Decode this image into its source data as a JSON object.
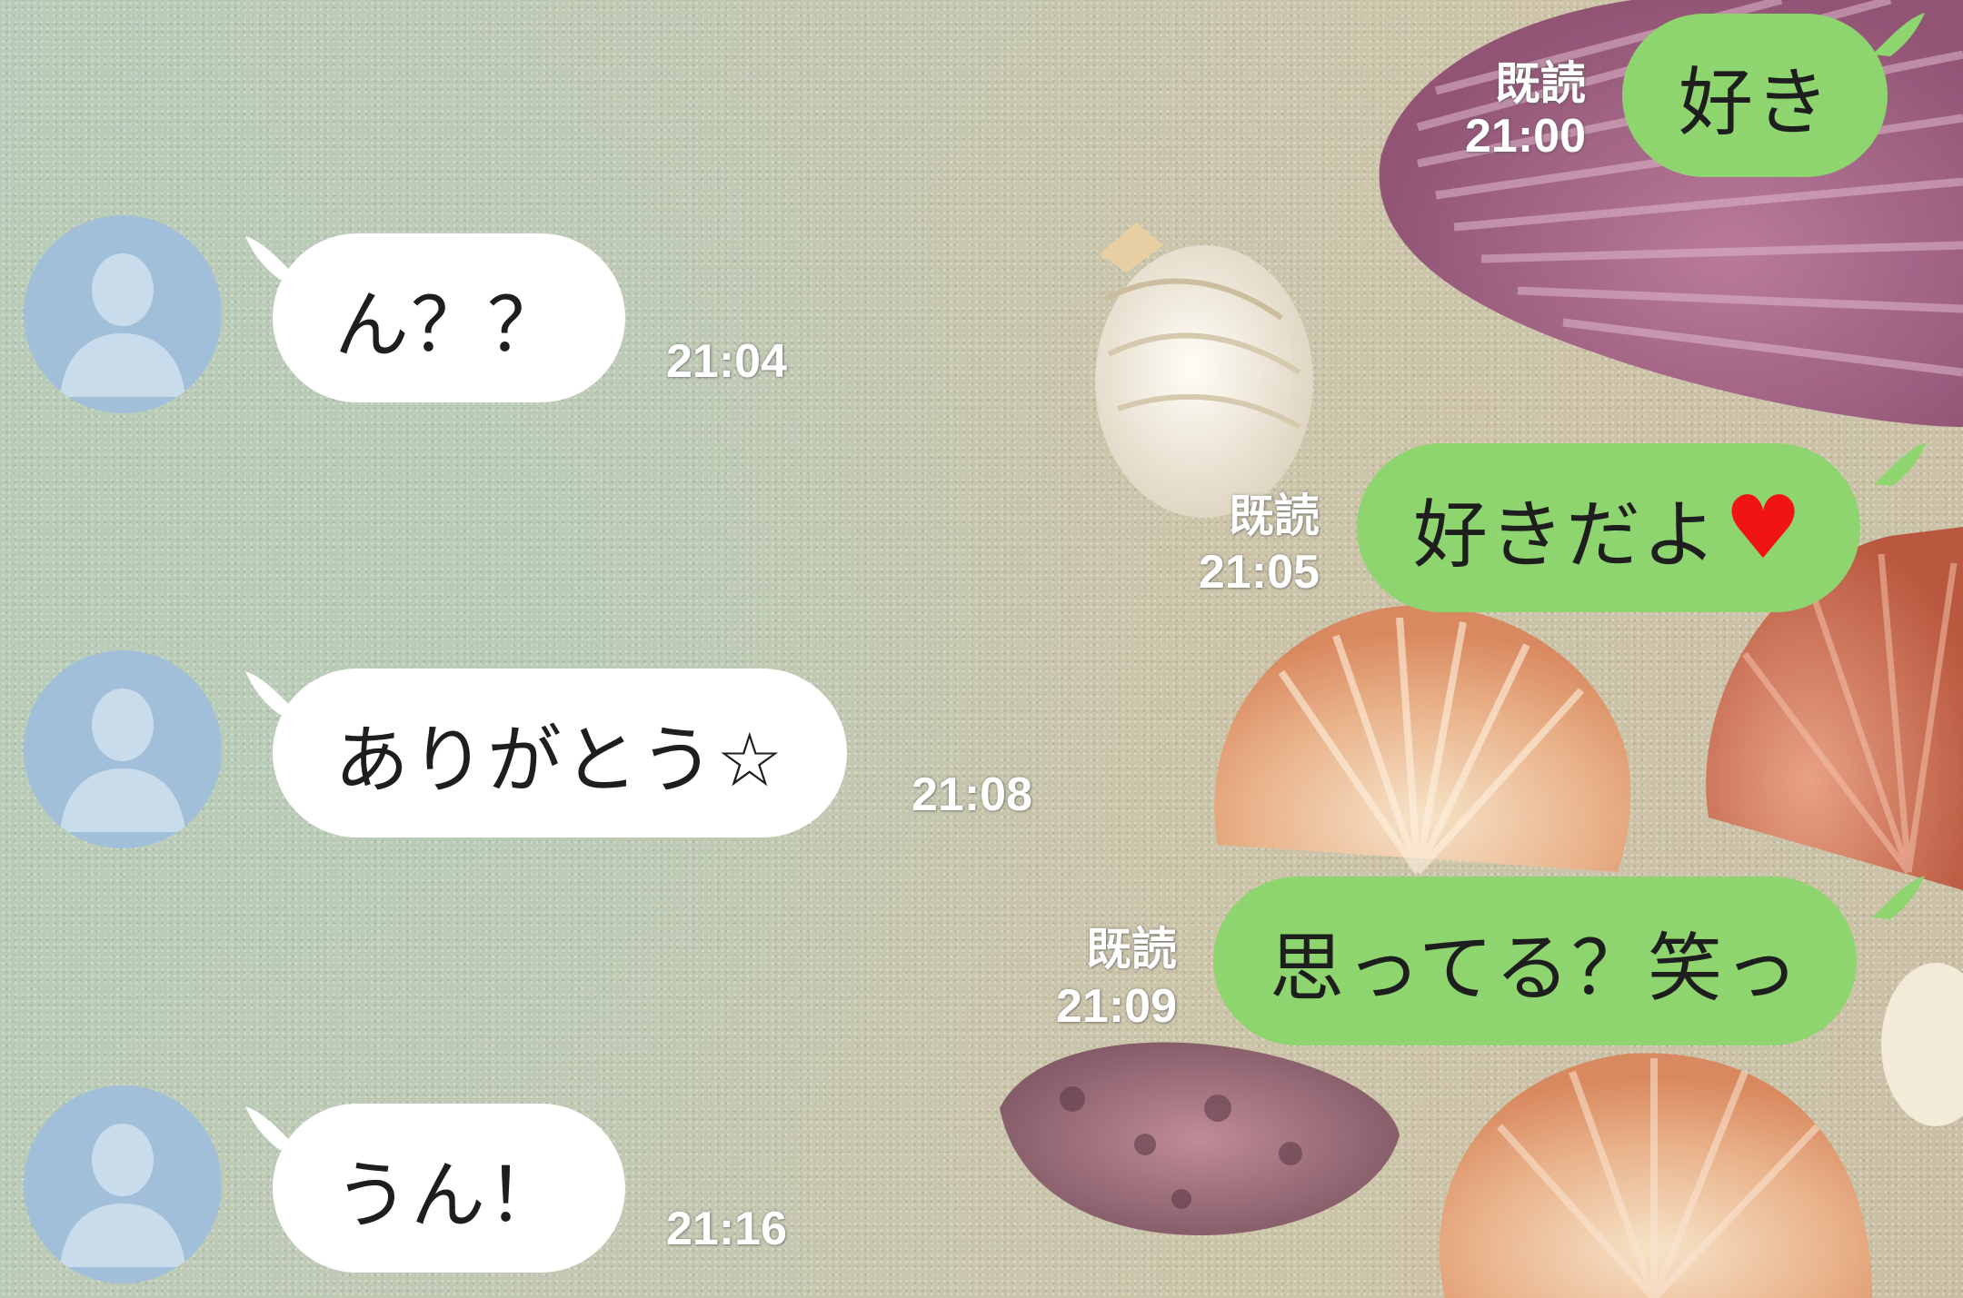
{
  "colors": {
    "incoming_bubble": "#ffffff",
    "outgoing_bubble": "#8ed56f",
    "avatar": "#a2bfd9",
    "heart": "#f21313",
    "meta_text": "#ffffff"
  },
  "messages": [
    {
      "direction": "out",
      "text": "好き",
      "read_label": "既読",
      "time": "21:00"
    },
    {
      "direction": "in",
      "text": "ん？？",
      "time": "21:04",
      "avatar_icon": "default-user-icon"
    },
    {
      "direction": "out",
      "text": "好きだよ",
      "emoji": "♥",
      "read_label": "既読",
      "time": "21:05"
    },
    {
      "direction": "in",
      "text": "ありがとう☆",
      "time": "21:08",
      "avatar_icon": "default-user-icon"
    },
    {
      "direction": "out",
      "text": "思ってる？笑っ",
      "read_label": "既読",
      "time": "21:09"
    },
    {
      "direction": "in",
      "text": "うん！",
      "time": "21:16",
      "avatar_icon": "default-user-icon"
    }
  ]
}
